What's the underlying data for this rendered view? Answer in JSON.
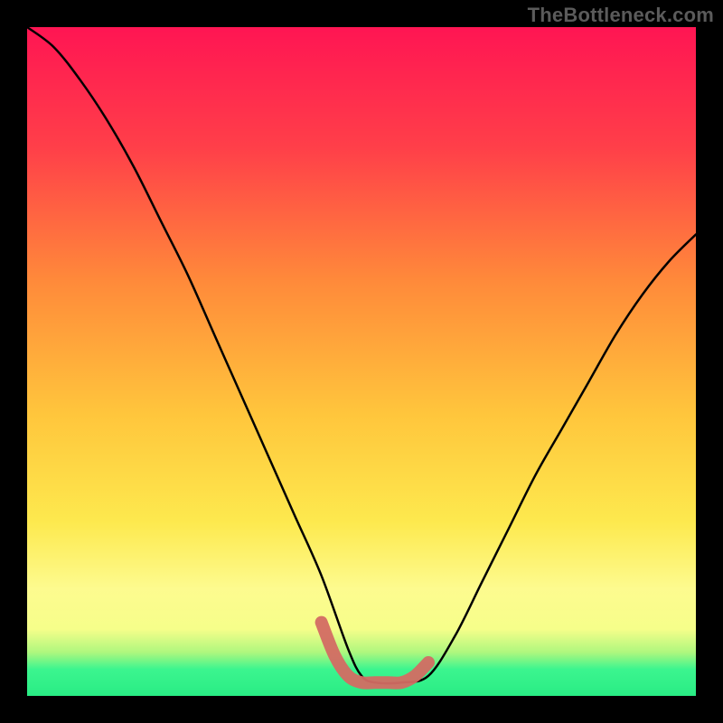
{
  "watermark": "TheBottleneck.com",
  "chart_data": {
    "type": "line",
    "title": "",
    "xlabel": "",
    "ylabel": "",
    "xlim": [
      0,
      100
    ],
    "ylim": [
      0,
      100
    ],
    "grid": false,
    "series": [
      {
        "name": "bottleneck-curve",
        "stroke": "#000000",
        "x": [
          0,
          4,
          8,
          12,
          16,
          20,
          24,
          28,
          32,
          36,
          40,
          44,
          48,
          50,
          52,
          56,
          60,
          64,
          68,
          72,
          76,
          80,
          84,
          88,
          92,
          96,
          100
        ],
        "y": [
          100,
          97,
          92,
          86,
          79,
          71,
          63,
          54,
          45,
          36,
          27,
          18,
          7,
          3,
          2,
          2,
          3,
          9,
          17,
          25,
          33,
          40,
          47,
          54,
          60,
          65,
          69
        ]
      },
      {
        "name": "flat-zone-marker",
        "stroke": "#d36b63",
        "x": [
          44,
          46,
          48,
          50,
          52,
          54,
          56,
          58,
          60
        ],
        "y": [
          11,
          6,
          3,
          2,
          2,
          2,
          2,
          3,
          5
        ]
      }
    ],
    "bands": [
      {
        "name": "green-base",
        "from": 0,
        "to": 7,
        "top_color": "#3cf58f",
        "bottom_color": "#29ec84"
      },
      {
        "name": "pale-yellow",
        "from": 7,
        "to": 22,
        "top_color": "#fdfb9a",
        "bottom_color": "#f8f98e"
      },
      {
        "name": "yellow",
        "from": 22,
        "to": 42,
        "top_color": "#fde24e",
        "bottom_color": "#fef162"
      },
      {
        "name": "orange",
        "from": 42,
        "to": 70,
        "top_color": "#ff8a3a",
        "bottom_color": "#ffc13e"
      },
      {
        "name": "red",
        "from": 70,
        "to": 100,
        "top_color": "#ff1553",
        "bottom_color": "#ff5b3f"
      }
    ]
  }
}
